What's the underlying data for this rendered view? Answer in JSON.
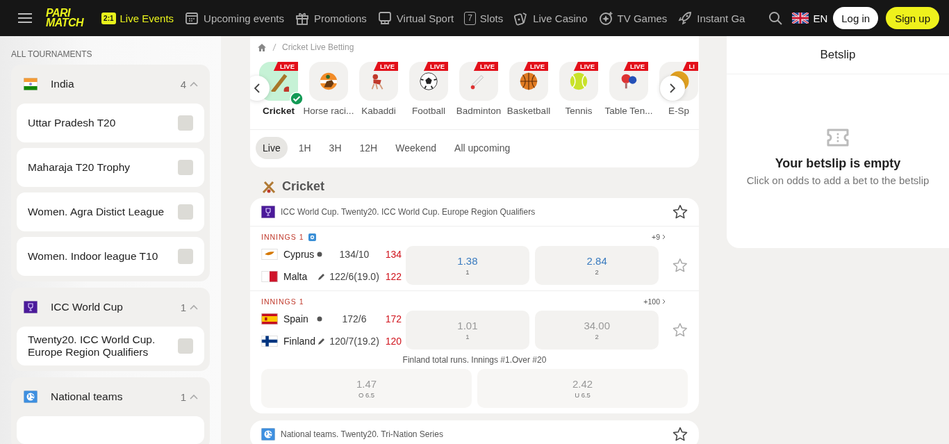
{
  "header": {
    "logo": [
      "PARI",
      "MATCH"
    ],
    "nav": [
      {
        "kind": "live",
        "badge": "2:1",
        "label": "Live Events",
        "selected": true
      },
      {
        "kind": "calendar",
        "label": "Upcoming events",
        "selected": false
      },
      {
        "kind": "gift",
        "label": "Promotions",
        "selected": false
      },
      {
        "kind": "gamepad",
        "label": "Virtual Sport",
        "selected": false
      },
      {
        "kind": "slots",
        "badge": "7",
        "label": "Slots",
        "selected": false
      },
      {
        "kind": "cards",
        "label": "Live Casino",
        "selected": false
      },
      {
        "kind": "tvgames",
        "label": "TV Games",
        "selected": false
      },
      {
        "kind": "rocket",
        "label": "Instant Ga",
        "selected": false
      }
    ],
    "language": "EN",
    "login": "Log in",
    "signup": "Sign up"
  },
  "sidebar": {
    "title": "ALL TOURNAMENTS",
    "groups": [
      {
        "flag": {
          "kind": "india"
        },
        "name": "India",
        "count": "4",
        "expanded": true,
        "items": [
          {
            "name": "Uttar Pradesh T20",
            "checked": false
          },
          {
            "name": "Maharaja T20 Trophy",
            "checked": false
          },
          {
            "name": "Women. Agra Distict League",
            "checked": false
          },
          {
            "name": "Women. Indoor league T10",
            "checked": false
          }
        ]
      },
      {
        "flag": {
          "kind": "icc"
        },
        "name": "ICC World Cup",
        "count": "1",
        "expanded": true,
        "items": [
          {
            "name": "Twenty20. ICC World Cup. Europe Region Qualifiers",
            "checked": false
          }
        ]
      },
      {
        "flag": {
          "kind": "globe"
        },
        "name": "National teams",
        "count": "1",
        "expanded": true
      }
    ]
  },
  "breadcrumb": "Cricket Live Betting",
  "sports": [
    {
      "kind": "cricket",
      "label": "Cricket",
      "live": true,
      "live_text": "LIVE",
      "selected": true
    },
    {
      "kind": "horse",
      "label": "Horse raci...",
      "live": false,
      "selected": false
    },
    {
      "kind": "kabaddi",
      "label": "Kabaddi",
      "live": true,
      "live_text": "LIVE",
      "selected": false
    },
    {
      "kind": "football",
      "label": "Football",
      "live": true,
      "live_text": "LIVE",
      "selected": false
    },
    {
      "kind": "badminton",
      "label": "Badminton",
      "live": true,
      "live_text": "LIVE",
      "selected": false
    },
    {
      "kind": "basketball",
      "label": "Basketball",
      "live": true,
      "live_text": "LIVE",
      "selected": false
    },
    {
      "kind": "tennis",
      "label": "Tennis",
      "live": true,
      "live_text": "LIVE",
      "selected": false
    },
    {
      "kind": "tabletennis",
      "label": "Table Ten...",
      "live": true,
      "live_text": "LIVE",
      "selected": false
    },
    {
      "kind": "esports",
      "label": "E-Sp",
      "live": true,
      "live_text": "LI",
      "selected": false
    }
  ],
  "time_filters": [
    {
      "label": "Live",
      "selected": true
    },
    {
      "label": "1H",
      "selected": false
    },
    {
      "label": "3H",
      "selected": false
    },
    {
      "label": "12H",
      "selected": false
    },
    {
      "label": "Weekend",
      "selected": false
    },
    {
      "label": "All upcoming",
      "selected": false
    }
  ],
  "section_title": "Cricket",
  "events": [
    {
      "emblem": {
        "kind": "icc"
      },
      "tournament": "ICC World Cup. Twenty20. ICC World Cup. Europe Region Qualifiers",
      "matches": [
        {
          "period": "INNINGS 1",
          "info": true,
          "more": "+9",
          "suspended": false,
          "teams": [
            {
              "flag": {
                "kind": "cyprus"
              },
              "name": "Cyprus",
              "indicator": {
                "kind": "ball"
              },
              "score": "134/10",
              "runs": "134"
            },
            {
              "flag": {
                "kind": "malta"
              },
              "name": "Malta",
              "indicator": {
                "kind": "bat"
              },
              "score": "122/6(19.0)",
              "runs": "122"
            }
          ],
          "odds": [
            {
              "value": "1.38",
              "label": "1"
            },
            {
              "value": "2.84",
              "label": "2"
            }
          ]
        },
        {
          "period": "INNINGS 1",
          "info": false,
          "more": "+100",
          "suspended": true,
          "teams": [
            {
              "flag": {
                "kind": "spain"
              },
              "name": "Spain",
              "indicator": {
                "kind": "ball"
              },
              "score": "172/6",
              "runs": "172"
            },
            {
              "flag": {
                "kind": "finland"
              },
              "name": "Finland",
              "indicator": {
                "kind": "bat"
              },
              "score": "120/7(19.2)",
              "runs": "120"
            }
          ],
          "odds": [
            {
              "value": "1.01",
              "label": "1"
            },
            {
              "value": "34.00",
              "label": "2"
            }
          ],
          "market": {
            "title": "Finland total runs. Innings #1.Over #20",
            "odds": [
              {
                "value": "1.47",
                "label": "O 6.5"
              },
              {
                "value": "2.42",
                "label": "U 6.5"
              }
            ]
          }
        }
      ]
    },
    {
      "emblem": {
        "kind": "globe"
      },
      "tournament": "National teams. Twenty20. Tri-Nation Series"
    }
  ],
  "betslip": {
    "title": "Betslip",
    "empty_title": "Your betslip is empty",
    "empty_text": "Click on odds to add a bet to the betslip"
  }
}
